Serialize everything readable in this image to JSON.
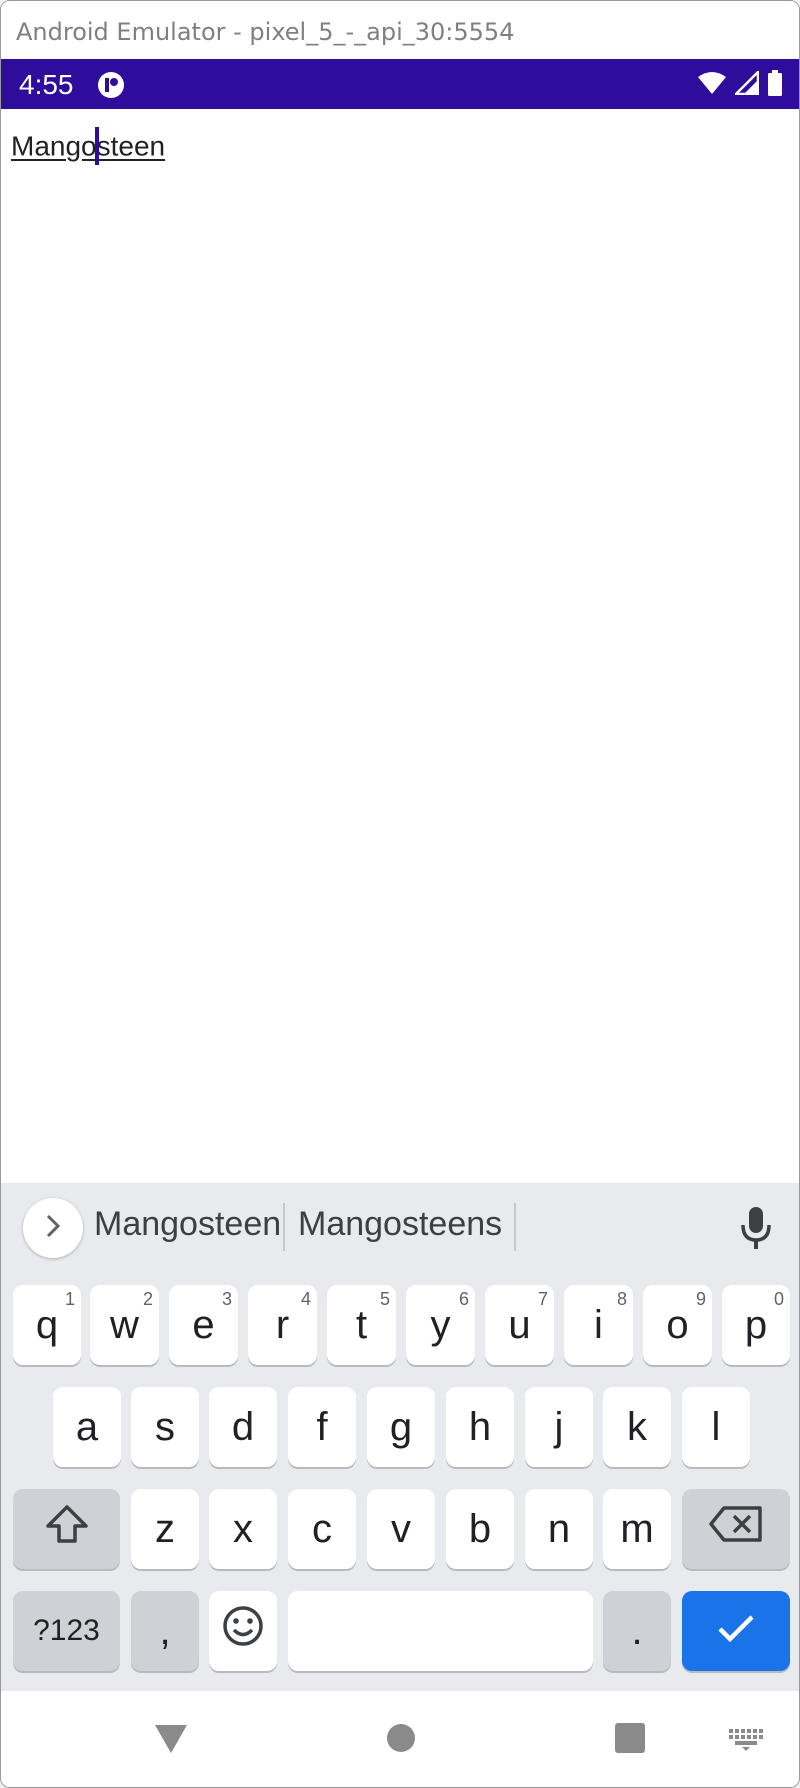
{
  "window": {
    "title": "Android Emulator - pixel_5_-_api_30:5554"
  },
  "status_bar": {
    "time": "4:55",
    "bg_color": "#2e0c9c"
  },
  "editor": {
    "text_before_cursor": "Mango",
    "text_after_cursor": "steen"
  },
  "suggestions": [
    "Mangosteen",
    "Mangosteens"
  ],
  "keyboard": {
    "row1": [
      {
        "label": "q",
        "hint": "1"
      },
      {
        "label": "w",
        "hint": "2"
      },
      {
        "label": "e",
        "hint": "3"
      },
      {
        "label": "r",
        "hint": "4"
      },
      {
        "label": "t",
        "hint": "5"
      },
      {
        "label": "y",
        "hint": "6"
      },
      {
        "label": "u",
        "hint": "7"
      },
      {
        "label": "i",
        "hint": "8"
      },
      {
        "label": "o",
        "hint": "9"
      },
      {
        "label": "p",
        "hint": "0"
      }
    ],
    "row2": [
      "a",
      "s",
      "d",
      "f",
      "g",
      "h",
      "j",
      "k",
      "l"
    ],
    "row3": [
      "z",
      "x",
      "c",
      "v",
      "b",
      "n",
      "m"
    ],
    "symbols_label": "?123",
    "comma_label": ",",
    "period_label": ".",
    "enter_color": "#1a73e8"
  },
  "icons": {
    "status": [
      "app-notification-icon",
      "wifi-icon",
      "signal-icon",
      "battery-icon"
    ],
    "suggest_bar": [
      "chevron-right-icon",
      "microphone-icon"
    ],
    "keys": [
      "shift-icon",
      "backspace-icon",
      "emoji-icon",
      "checkmark-icon"
    ],
    "nav": [
      "back-icon",
      "home-icon",
      "recents-icon",
      "keyboard-switch-icon"
    ]
  }
}
